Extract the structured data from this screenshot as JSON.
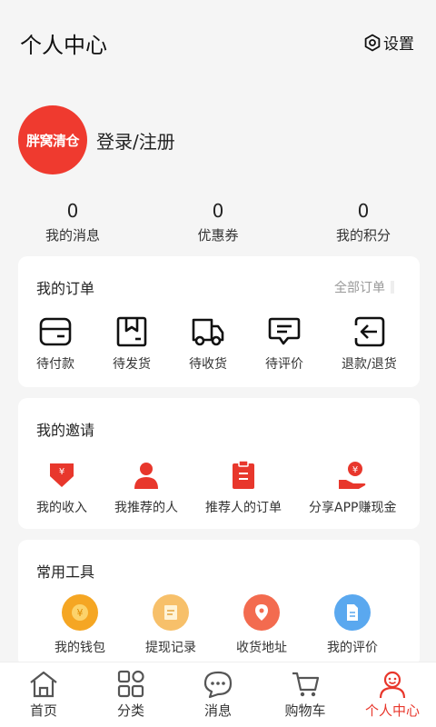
{
  "header": {
    "title": "个人中心",
    "settings_label": "设置"
  },
  "profile": {
    "avatar_text": "胖窝清仓",
    "login_label": "登录/注册"
  },
  "stats": [
    {
      "value": "0",
      "label": "我的消息"
    },
    {
      "value": "0",
      "label": "优惠券"
    },
    {
      "value": "0",
      "label": "我的积分"
    }
  ],
  "orders": {
    "title": "我的订单",
    "all_link": "全部订单",
    "items": [
      {
        "label": "待付款",
        "icon": "wallet-icon"
      },
      {
        "label": "待发货",
        "icon": "box-icon"
      },
      {
        "label": "待收货",
        "icon": "truck-icon"
      },
      {
        "label": "待评价",
        "icon": "comment-icon"
      },
      {
        "label": "退款/退货",
        "icon": "return-icon"
      }
    ]
  },
  "invite": {
    "title": "我的邀请",
    "items": [
      {
        "label": "我的收入",
        "icon": "income-icon"
      },
      {
        "label": "我推荐的人",
        "icon": "person-icon"
      },
      {
        "label": "推荐人的订单",
        "icon": "clipboard-icon"
      },
      {
        "label": "分享APP赚现金",
        "icon": "share-cash-icon"
      }
    ]
  },
  "tools": {
    "title": "常用工具",
    "items": [
      {
        "label": "我的钱包",
        "icon": "coin-icon",
        "color": "#f5a623"
      },
      {
        "label": "提现记录",
        "icon": "note-icon",
        "color": "#f7c06a"
      },
      {
        "label": "收货地址",
        "icon": "location-icon",
        "color": "#f36b4f"
      },
      {
        "label": "我的评价",
        "icon": "document-icon",
        "color": "#5aa8ef"
      }
    ]
  },
  "tabbar": [
    {
      "label": "首页",
      "icon": "home-icon"
    },
    {
      "label": "分类",
      "icon": "category-icon"
    },
    {
      "label": "消息",
      "icon": "message-icon"
    },
    {
      "label": "购物车",
      "icon": "cart-icon"
    },
    {
      "label": "个人中心",
      "icon": "profile-icon",
      "active": true
    }
  ],
  "colors": {
    "accent": "#e8372c",
    "background": "#f5f5f5"
  }
}
